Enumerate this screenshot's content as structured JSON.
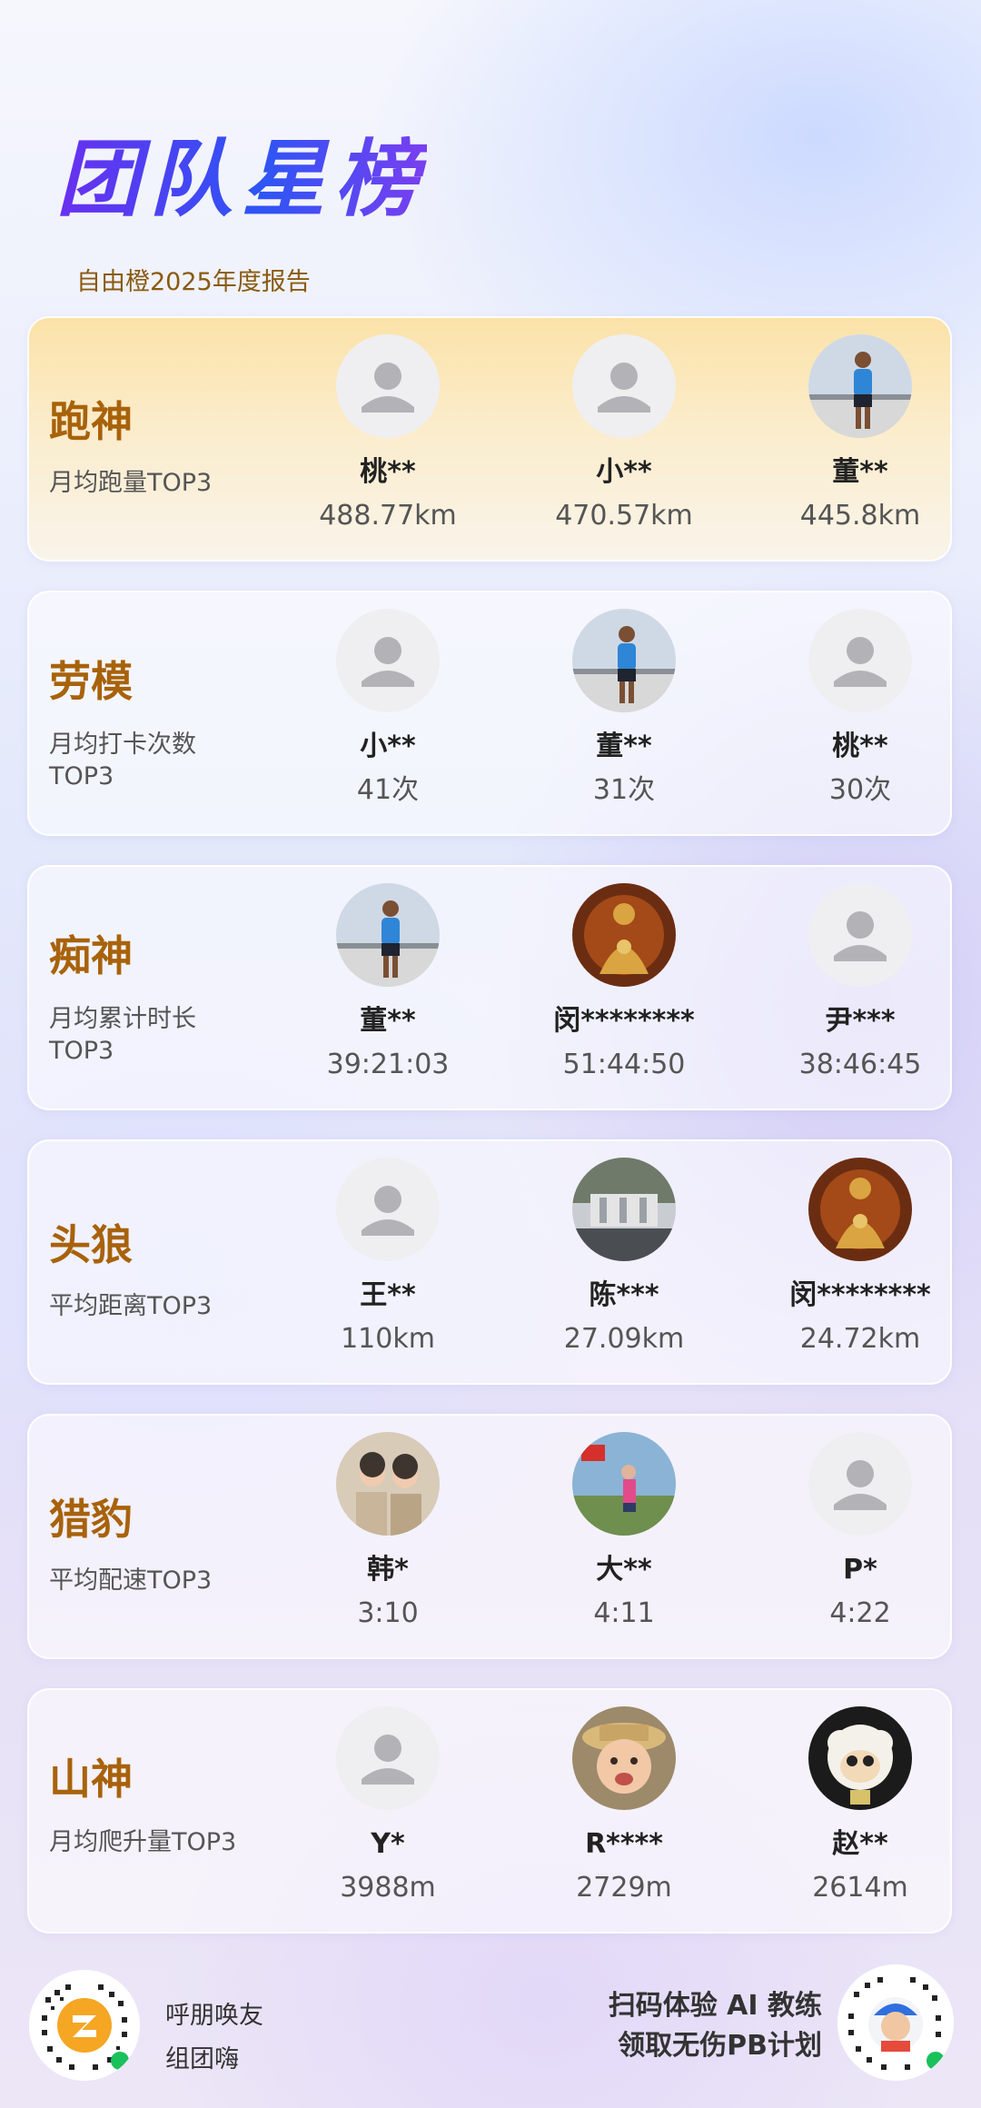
{
  "header": {
    "title": "团队星榜",
    "subtitle": "自由橙2025年度报告"
  },
  "categories": [
    {
      "title": "跑神",
      "sub": "月均跑量TOP3",
      "entries": [
        {
          "name": "桃**",
          "value": "488.77km"
        },
        {
          "name": "小**",
          "value": "470.57km"
        },
        {
          "name": "董**",
          "value": "445.8km"
        }
      ]
    },
    {
      "title": "劳模",
      "sub": "月均打卡次数TOP3",
      "entries": [
        {
          "name": "小**",
          "value": "41次"
        },
        {
          "name": "董**",
          "value": "31次"
        },
        {
          "name": "桃**",
          "value": "30次"
        }
      ]
    },
    {
      "title": "痴神",
      "sub": "月均累计时长TOP3",
      "entries": [
        {
          "name": "董**",
          "value": "39:21:03"
        },
        {
          "name": "闵********",
          "value": "51:44:50"
        },
        {
          "name": "尹***",
          "value": "38:46:45"
        }
      ]
    },
    {
      "title": "头狼",
      "sub": "平均距离TOP3",
      "entries": [
        {
          "name": "王**",
          "value": "110km"
        },
        {
          "name": "陈***",
          "value": "27.09km"
        },
        {
          "name": "闵********",
          "value": "24.72km"
        }
      ]
    },
    {
      "title": "猎豹",
      "sub": "平均配速TOP3",
      "entries": [
        {
          "name": "韩*",
          "value": "3:10"
        },
        {
          "name": "大**",
          "value": "4:11"
        },
        {
          "name": "P*",
          "value": "4:22"
        }
      ]
    },
    {
      "title": "山神",
      "sub": "月均爬升量TOP3",
      "entries": [
        {
          "name": "Y*",
          "value": "3988m"
        },
        {
          "name": "R****",
          "value": "2729m"
        },
        {
          "name": "赵**",
          "value": "2614m"
        }
      ]
    }
  ],
  "footer": {
    "left_line1": "呼朋唤友",
    "left_line2": "组团嗨",
    "right_line1": "扫码体验 AI 教练",
    "right_line2": "领取无伤PB计划"
  },
  "colors": {
    "accent_gold": "#a8620a",
    "title_start": "#6a2ff0",
    "title_end": "#2d55f5"
  },
  "icons": [
    "default-avatar-icon",
    "runner-photo",
    "buddha-statue-photo",
    "couple-photo",
    "qr-code-icon"
  ]
}
